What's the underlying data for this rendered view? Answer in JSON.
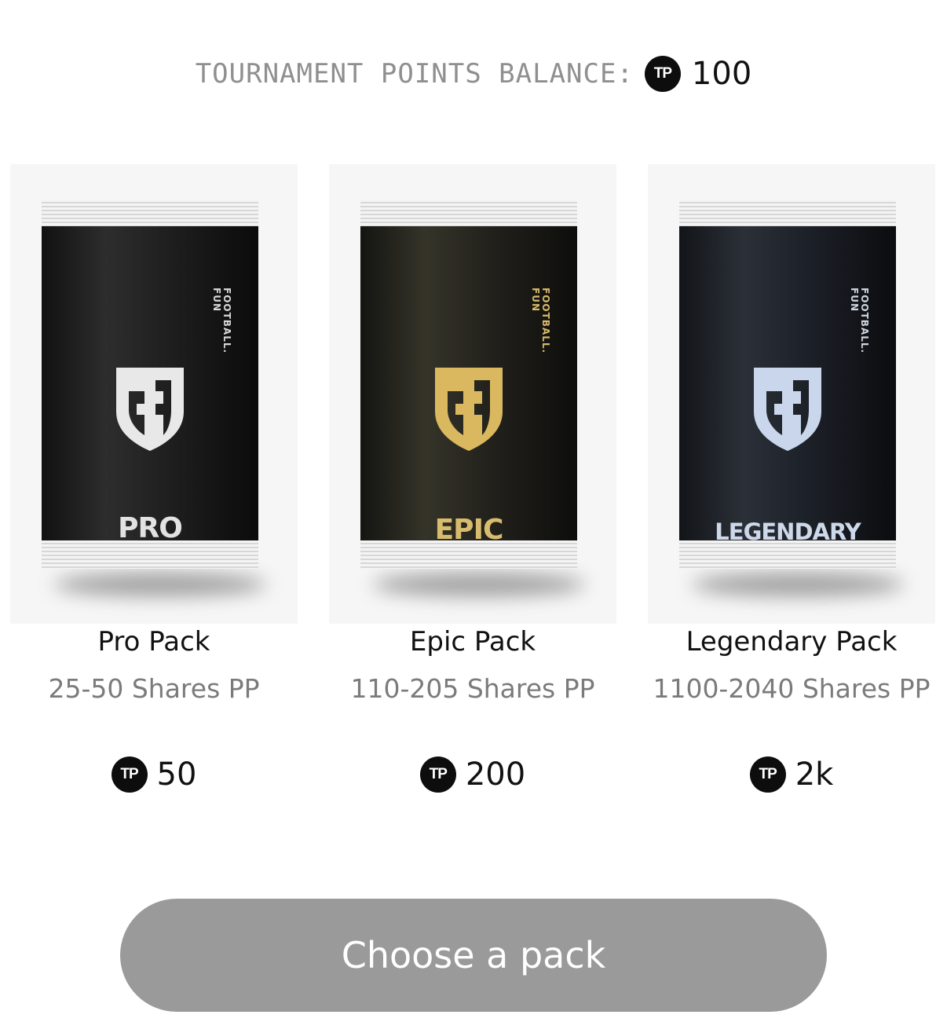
{
  "balance": {
    "label": "TOURNAMENT POINTS BALANCE:",
    "currency_symbol": "TP",
    "value": "100"
  },
  "packs": [
    {
      "sachet_brand": "FOOTBALL.\nFUN",
      "sachet_label": "PRO",
      "title": "Pro Pack",
      "shares": "25-50 Shares PP",
      "currency_symbol": "TP",
      "price": "50",
      "logo_color": "#e8e8e8"
    },
    {
      "sachet_brand": "FOOTBALL.\nFUN",
      "sachet_label": "EPIC",
      "title": "Epic Pack",
      "shares": "110-205 Shares PP",
      "currency_symbol": "TP",
      "price": "200",
      "logo_color": "#d9b85f"
    },
    {
      "sachet_brand": "FOOTBALL.\nFUN",
      "sachet_label": "LEGENDARY",
      "title": "Legendary Pack",
      "shares": "1100-2040 Shares PP",
      "currency_symbol": "TP",
      "price": "2k",
      "logo_color": "#c9d6ec"
    }
  ],
  "cta": {
    "label": "Choose a pack"
  },
  "colors": {
    "cta_background": "#9a9a9a",
    "coin_background": "#0d0d0d",
    "muted_text": "#8f8f8f"
  }
}
